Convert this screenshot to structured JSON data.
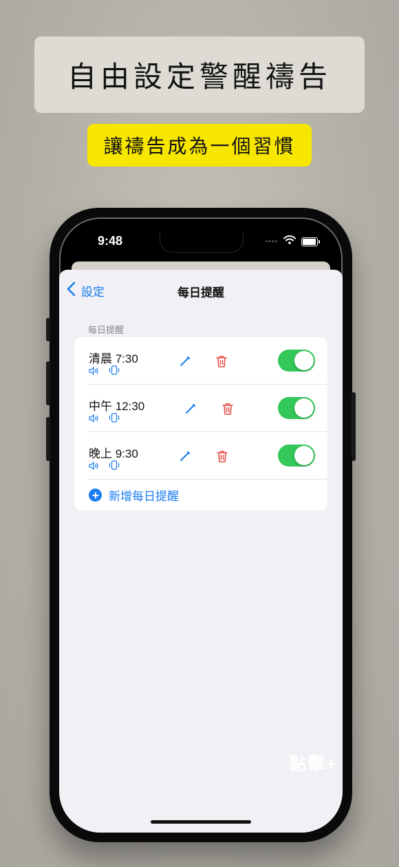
{
  "promo": {
    "headline": "自由設定警醒禱告",
    "subline": "讓禱告成為一個習慣"
  },
  "status_bar": {
    "time": "9:48",
    "signal_dots": "••••"
  },
  "nav": {
    "back_label": "設定",
    "title": "每日提醒"
  },
  "section": {
    "header": "每日提醒"
  },
  "reminders": [
    {
      "time_label": "清晨 7:30",
      "enabled": true
    },
    {
      "time_label": "中午 12:30",
      "enabled": true
    },
    {
      "time_label": "晚上 9:30",
      "enabled": true
    }
  ],
  "add_button": {
    "label": "新增每日提醒"
  },
  "overlay_hint": "點擊+",
  "colors": {
    "accent": "#1a7cf0",
    "toggle_on": "#34c759",
    "delete": "#e5483f",
    "promo_yellow": "#f7e600"
  }
}
